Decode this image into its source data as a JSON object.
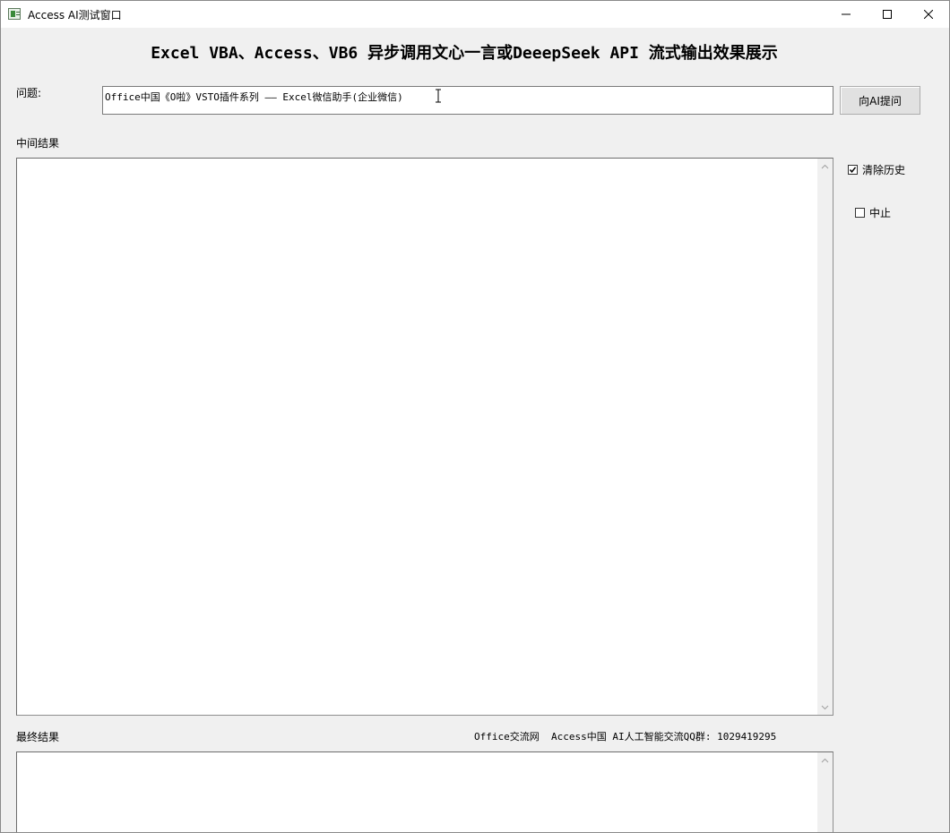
{
  "window": {
    "title": "Access AI测试窗口",
    "icon": "access-form-icon",
    "controls": [
      "minimize-icon",
      "maximize-icon",
      "close-icon"
    ]
  },
  "heading": "Excel VBA、Access、VB6 异步调用文心一言或DeeepSeek API 流式输出效果展示",
  "question": {
    "label": "问题:",
    "value": "Office中国《O啦》VSTO插件系列 —— Excel微信助手(企业微信)"
  },
  "ask_button": "向AI提问",
  "intermediate": {
    "label": "中间结果",
    "value": ""
  },
  "options": {
    "clear_history": {
      "label": "清除历史",
      "checked": true
    },
    "stop": {
      "label": "中止",
      "checked": false
    }
  },
  "final": {
    "label": "最终结果",
    "value": ""
  },
  "footer": "Office交流网  Access中国 AI人工智能交流QQ群: 1029419295"
}
